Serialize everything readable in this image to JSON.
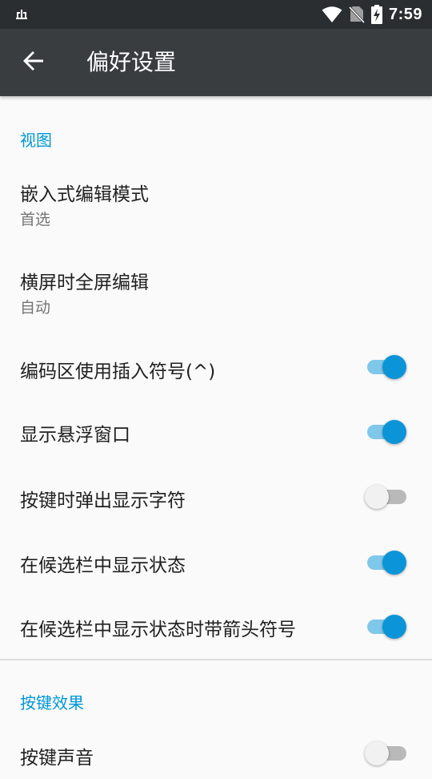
{
  "status_bar": {
    "time": "7:59",
    "left_icon": "usb-icon",
    "icons": [
      "wifi-icon",
      "no-sim-icon",
      "battery-charging-icon"
    ]
  },
  "app_bar": {
    "title": "偏好设置",
    "back_icon": "arrow-back-icon"
  },
  "sections": {
    "view": {
      "header": "视图",
      "embedded_edit_mode": {
        "title": "嵌入式编辑模式",
        "summary": "首选"
      },
      "landscape_fullscreen": {
        "title": "横屏时全屏编辑",
        "summary": "自动"
      },
      "insert_caret": {
        "title": "编码区使用插入符号(^)",
        "checked": true
      },
      "floating_window": {
        "title": "显示悬浮窗口",
        "checked": true
      },
      "key_popup": {
        "title": "按键时弹出显示字符",
        "checked": false
      },
      "candidate_status": {
        "title": "在候选栏中显示状态",
        "checked": true
      },
      "candidate_arrow": {
        "title": "在候选栏中显示状态时带箭头符号",
        "checked": true
      }
    },
    "key_effect": {
      "header": "按键效果",
      "key_sound": {
        "title": "按键声音",
        "checked": false
      }
    }
  },
  "colors": {
    "accent": "#0097d7",
    "switch_thumb_on": "#0b95d8",
    "switch_track_on": "#80c8ea",
    "app_bar": "#3a3d40",
    "status_bar": "#2b2e31",
    "background": "#fafafa"
  }
}
